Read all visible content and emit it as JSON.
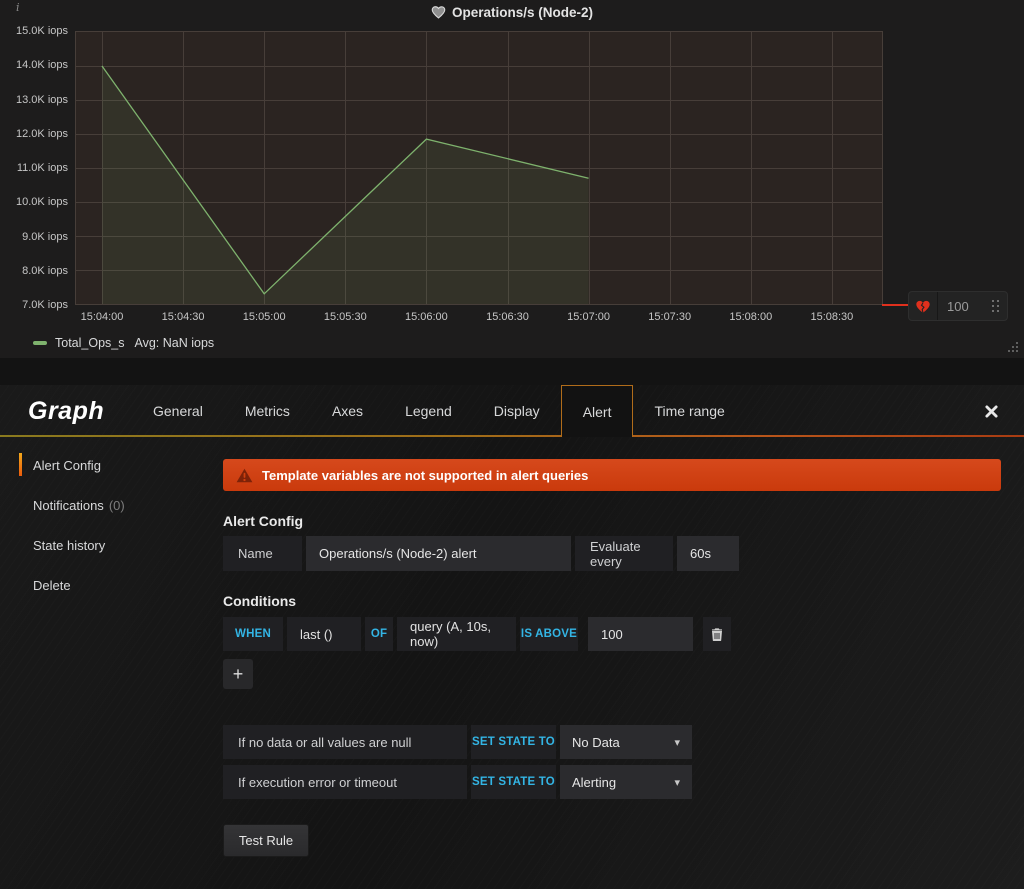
{
  "panel": {
    "title": "Operations/s (Node-2)",
    "info_icon": "i"
  },
  "chart_data": {
    "type": "line",
    "title": "Operations/s (Node-2)",
    "x_ticks": [
      "15:04:00",
      "15:04:30",
      "15:05:00",
      "15:05:30",
      "15:06:00",
      "15:06:30",
      "15:07:00",
      "15:07:30",
      "15:08:00",
      "15:08:30"
    ],
    "y_ticks": [
      "15.0K iops",
      "14.0K iops",
      "13.0K iops",
      "12.0K iops",
      "11.0K iops",
      "10.0K iops",
      "9.0K iops",
      "8.0K iops",
      "7.0K iops"
    ],
    "ylim": [
      7000,
      15000
    ],
    "grid": true,
    "legend_position": "bottom",
    "series": [
      {
        "name": "Total_Ops_s",
        "avg_label": "Avg: NaN iops",
        "color": "#7eb26d",
        "points": [
          {
            "t": "15:04:00",
            "v": 14000
          },
          {
            "t": "15:05:00",
            "v": 7300
          },
          {
            "t": "15:06:00",
            "v": 11850
          },
          {
            "t": "15:07:00",
            "v": 10700
          }
        ]
      }
    ],
    "threshold": {
      "value": 100,
      "color": "#e0301d"
    }
  },
  "editor": {
    "panel_type": "Graph",
    "tabs": [
      {
        "label": "General",
        "active": false
      },
      {
        "label": "Metrics",
        "active": false
      },
      {
        "label": "Axes",
        "active": false
      },
      {
        "label": "Legend",
        "active": false
      },
      {
        "label": "Display",
        "active": false
      },
      {
        "label": "Alert",
        "active": true
      },
      {
        "label": "Time range",
        "active": false
      }
    ],
    "sidebar": [
      {
        "label": "Alert Config",
        "active": true
      },
      {
        "label": "Notifications",
        "suffix": "(0)",
        "active": false
      },
      {
        "label": "State history",
        "active": false
      },
      {
        "label": "Delete",
        "active": false
      }
    ],
    "warning": "Template variables are not supported in alert queries",
    "alert_config": {
      "heading": "Alert Config",
      "name_label": "Name",
      "name_value": "Operations/s (Node-2) alert",
      "evaluate_label": "Evaluate every",
      "evaluate_value": "60s"
    },
    "conditions": {
      "heading": "Conditions",
      "when": "WHEN",
      "reducer": "last ()",
      "of": "OF",
      "query": "query (A, 10s, now)",
      "operator": "IS ABOVE",
      "value": "100",
      "add_label": "+"
    },
    "states": [
      {
        "label": "If no data or all values are null",
        "keyword": "SET STATE TO",
        "value": "No Data"
      },
      {
        "label": "If execution error or timeout",
        "keyword": "SET STATE TO",
        "value": "Alerting"
      }
    ],
    "test_button": "Test Rule"
  },
  "colors": {
    "accent_blue": "#33b5e5",
    "banner_orange": "#d0400e",
    "series_green": "#7eb26d",
    "threshold_red": "#e0301d"
  }
}
